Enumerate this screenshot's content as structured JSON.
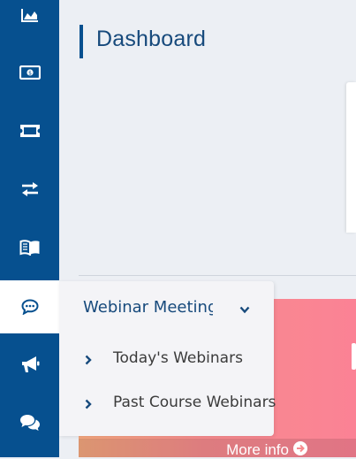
{
  "page": {
    "title": "Dashboard"
  },
  "sidebar": {
    "items": [
      {
        "icon": "area-chart-icon"
      },
      {
        "icon": "money-bill-icon"
      },
      {
        "icon": "ticket-icon"
      },
      {
        "icon": "exchange-arrows-icon"
      },
      {
        "icon": "open-book-icon"
      },
      {
        "icon": "comment-dots-icon",
        "active": true
      },
      {
        "icon": "bullhorn-icon"
      },
      {
        "icon": "comments-icon"
      }
    ]
  },
  "flyout": {
    "header_label": "Webinar Meetings",
    "items": [
      {
        "label": "Today's Webinars"
      },
      {
        "label": "Past Course Webinars"
      }
    ]
  },
  "promo": {
    "more_info_label": "More info"
  },
  "colors": {
    "sidebar_bg": "#06508f",
    "page_bg": "#eceff4",
    "title_text": "#174a7c",
    "promo_gradient_start": "#f4a77e",
    "promo_gradient_end": "#fb8295"
  }
}
